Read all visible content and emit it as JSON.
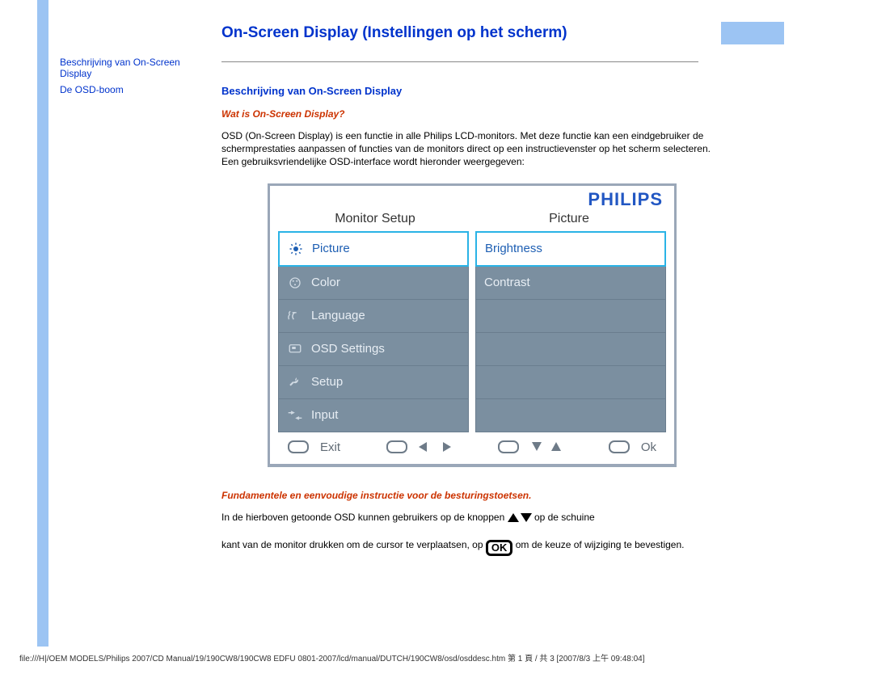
{
  "sidebar": {
    "link1": "Beschrijving van On-Screen Display",
    "link2": "De OSD-boom"
  },
  "page": {
    "title": "On-Screen Display (Instellingen op het scherm)",
    "sec_heading": "Beschrijving van On-Screen Display",
    "sub_q": "Wat is On-Screen Display?",
    "intro": "OSD (On-Screen Display) is een functie in alle Philips LCD-monitors. Met deze functie kan een eindgebruiker de schermprestaties aanpassen of functies van de monitors direct op een instructievenster op het scherm selecteren. Een gebruiksvriendelijke OSD-interface wordt hieronder weergegeven:",
    "instr_heading": "Fundamentele en eenvoudige instructie voor de besturingstoetsen.",
    "p2a": "In de hierboven getoonde OSD kunnen gebruikers op de knoppen ",
    "p2b": " op de schuine",
    "p3a": "kant van de monitor drukken om de cursor te verplaatsen, op ",
    "p3b": " om de keuze of wijziging te bevestigen."
  },
  "osd": {
    "logo": "PHILIPS",
    "col_left": "Monitor Setup",
    "col_right": "Picture",
    "left": {
      "picture": "Picture",
      "color": "Color",
      "language": "Language",
      "osd_settings": "OSD Settings",
      "setup": "Setup",
      "input": "Input"
    },
    "right": {
      "brightness": "Brightness",
      "contrast": "Contrast"
    },
    "footer": {
      "exit": "Exit",
      "ok": "Ok"
    }
  },
  "footer_path": "file:///H|/OEM MODELS/Philips 2007/CD Manual/19/190CW8/190CW8 EDFU 0801-2007/lcd/manual/DUTCH/190CW8/osd/osddesc.htm 第 1 頁 / 共 3  [2007/8/3 上午 09:48:04]"
}
